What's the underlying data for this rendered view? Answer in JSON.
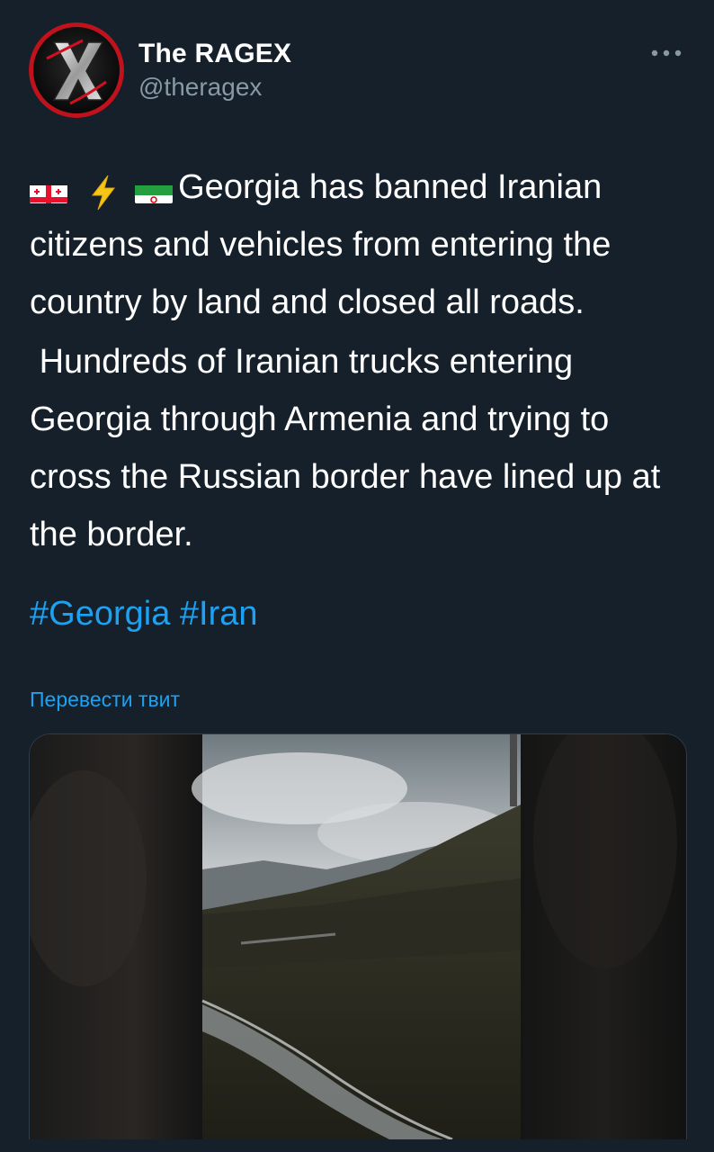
{
  "author": {
    "name": "The RAGEX",
    "handle": "@theragex"
  },
  "tweet": {
    "flags": [
      "georgia-flag",
      "lightning-bolt",
      "iran-flag"
    ],
    "paragraph1_text": "Georgia has banned Iranian citizens and vehicles from entering the country by land and closed all roads.",
    "paragraph2_text": " Hundreds of Iranian trucks entering Georgia through Armenia and trying to cross the Russian border have lined up at the border.",
    "hashtags": [
      "#Georgia",
      "#Iran"
    ]
  },
  "translate_link": "Перевести твит",
  "colors": {
    "background": "#15202b",
    "text": "#ffffff",
    "secondary_text": "#8899a6",
    "link": "#1da1f2"
  }
}
